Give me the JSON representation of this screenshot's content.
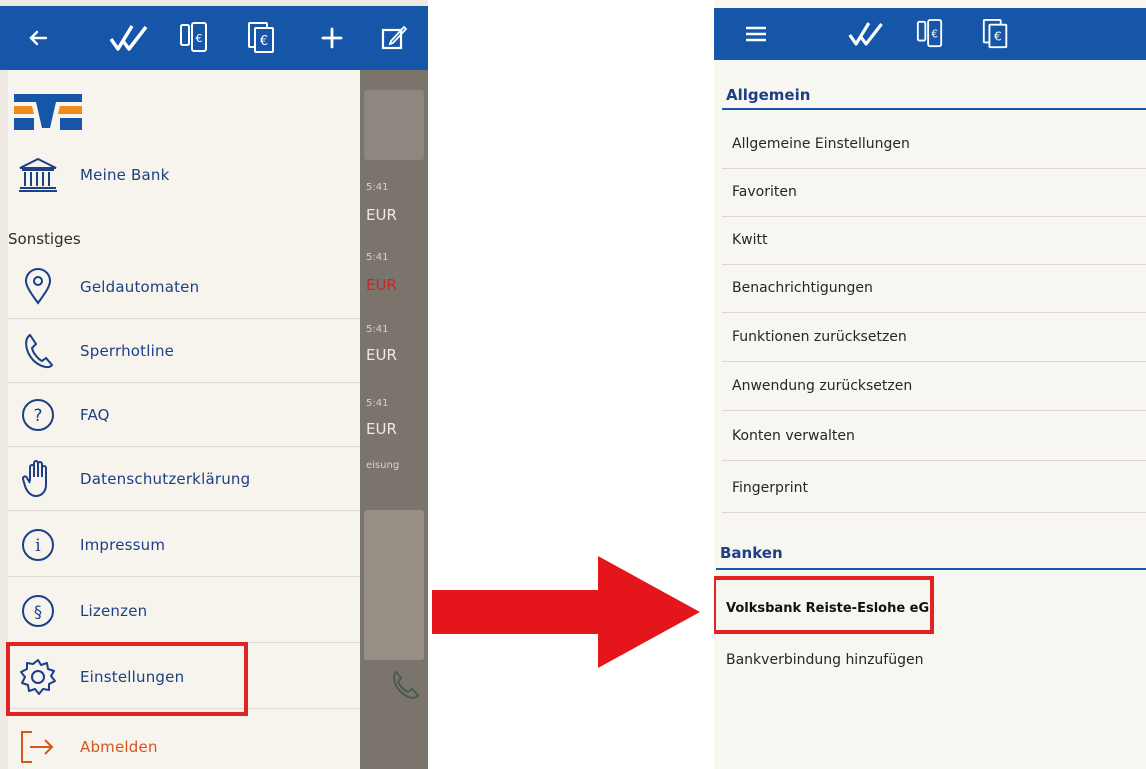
{
  "left_screen": {
    "toolbar": {
      "back_icon": "arrow-left-icon",
      "checkmark_icon": "double-check-icon",
      "transfer_icon": "phone-euro-icon",
      "documents_icon": "stacked-euro-icon",
      "add_icon": "plus-icon",
      "edit_icon": "edit-icon"
    },
    "background_fragments": {
      "times": [
        "5:41",
        "5:41",
        "5:41",
        "5:41"
      ],
      "currency": [
        "EUR",
        "EUR",
        "EUR",
        "EUR"
      ],
      "footer_fragment": "eisung"
    },
    "drawer": {
      "meine_bank": "Meine Bank",
      "section_title": "Sonstiges",
      "items": [
        {
          "label": "Geldautomaten",
          "icon": "location-pin-icon"
        },
        {
          "label": "Sperrhotline",
          "icon": "phone-icon"
        },
        {
          "label": "FAQ",
          "icon": "question-icon"
        },
        {
          "label": "Datenschutzerklärung",
          "icon": "hand-icon"
        },
        {
          "label": "Impressum",
          "icon": "info-icon"
        },
        {
          "label": "Lizenzen",
          "icon": "paragraph-icon"
        },
        {
          "label": "Einstellungen",
          "icon": "gear-icon"
        },
        {
          "label": "Abmelden",
          "icon": "logout-icon"
        }
      ]
    }
  },
  "right_screen": {
    "toolbar": {
      "menu_icon": "menu-icon",
      "checkmark_icon": "double-check-icon",
      "transfer_icon": "phone-euro-icon",
      "documents_icon": "stacked-euro-icon"
    },
    "section_general": "Allgemein",
    "general_items": [
      "Allgemeine Einstellungen",
      "Favoriten",
      "Kwitt",
      "Benachrichtigungen",
      "Funktionen zurücksetzen",
      "Anwendung zurücksetzen",
      "Konten verwalten",
      "Fingerprint"
    ],
    "section_banks": "Banken",
    "bank_items": [
      "Volksbank Reiste-Eslohe eG",
      "Bankverbindung hinzufügen"
    ]
  },
  "colors": {
    "toolbar_blue": "#1556a8",
    "label_blue": "#1c3f86",
    "highlight_red": "#e02424",
    "logout_orange": "#d4561e",
    "logo_orange": "#f08a1c"
  }
}
